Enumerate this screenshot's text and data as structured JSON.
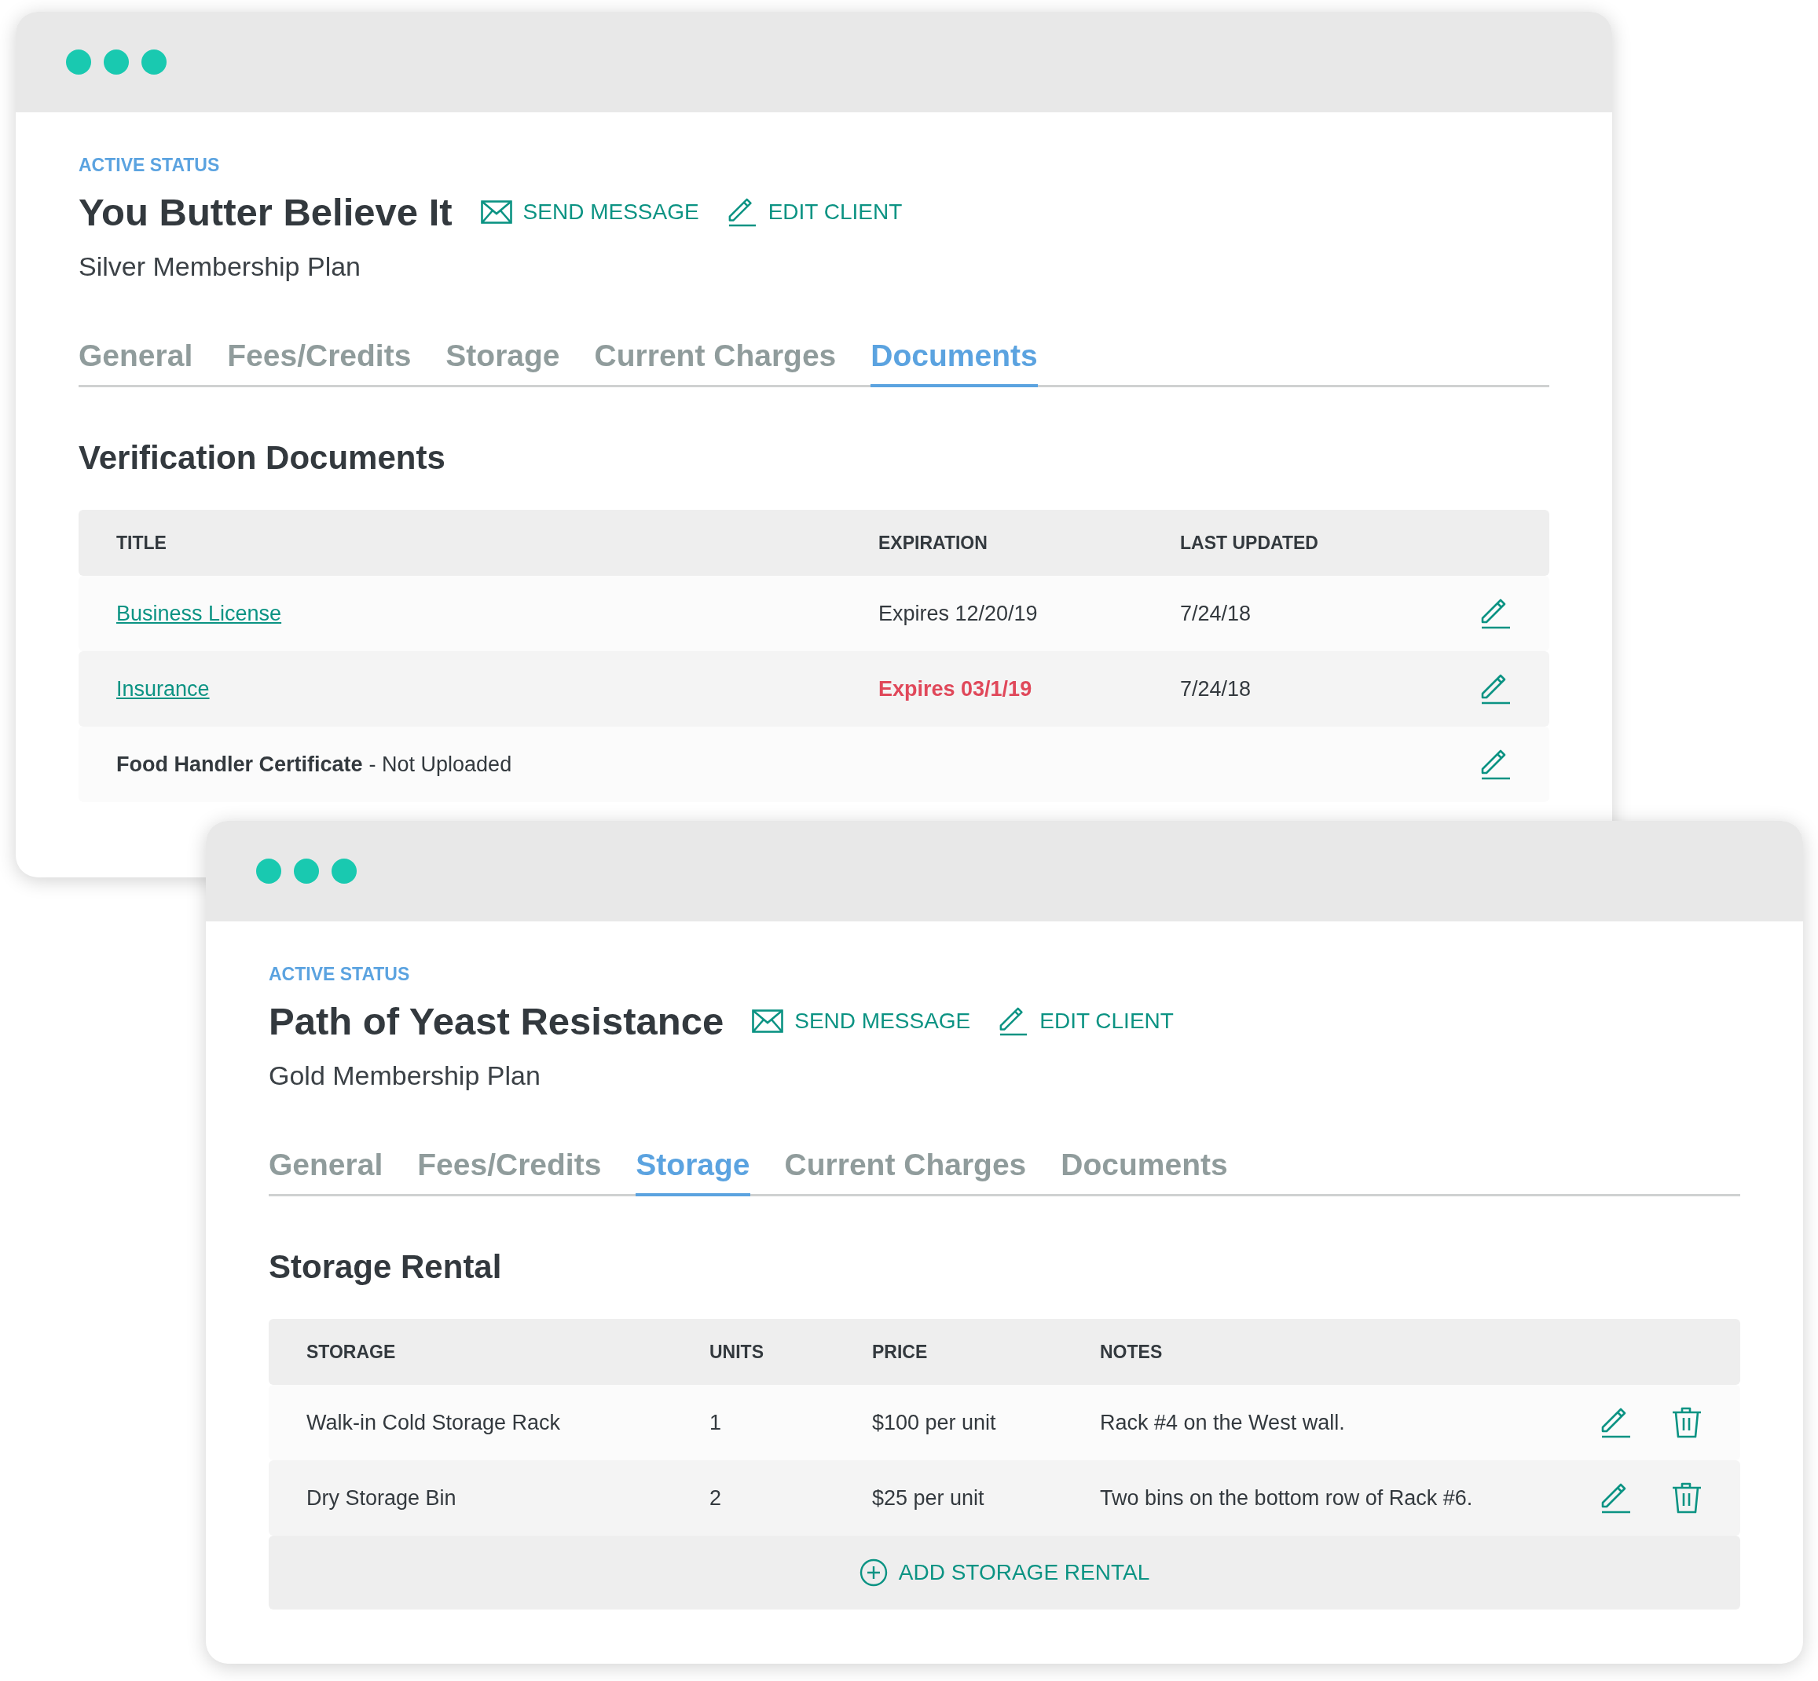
{
  "windows": [
    {
      "status": "ACTIVE STATUS",
      "name": "You Butter Believe It",
      "actions": [
        {
          "kind": "message",
          "label": "SEND MESSAGE"
        },
        {
          "kind": "edit",
          "label": "EDIT CLIENT"
        }
      ],
      "plan": "Silver Membership Plan",
      "tabs": [
        {
          "label": "General",
          "selected": false
        },
        {
          "label": "Fees/Credits",
          "selected": false
        },
        {
          "label": "Storage",
          "selected": false
        },
        {
          "label": "Current Charges",
          "selected": false
        },
        {
          "label": "Documents",
          "selected": true
        }
      ],
      "section_title": "Verification Documents",
      "table": {
        "kind": "documents",
        "columns": [
          "TITLE",
          "EXPIRATION",
          "LAST UPDATED"
        ],
        "rows": [
          {
            "title": "Business License",
            "kind": "link",
            "expiration": "Expires 12/20/19",
            "expired": false,
            "last_updated": "7/24/18"
          },
          {
            "title": "Insurance",
            "kind": "link",
            "expiration": "Expires 03/1/19",
            "expired": true,
            "last_updated": "7/24/18"
          },
          {
            "title": "Food Handler Certificate",
            "kind": "text",
            "note": "- Not Uploaded"
          }
        ]
      }
    },
    {
      "status": "ACTIVE STATUS",
      "name": "Path of Yeast Resistance",
      "actions": [
        {
          "kind": "message",
          "label": "SEND MESSAGE"
        },
        {
          "kind": "edit",
          "label": "EDIT CLIENT"
        }
      ],
      "plan": "Gold Membership Plan",
      "tabs": [
        {
          "label": "General",
          "selected": false
        },
        {
          "label": "Fees/Credits",
          "selected": false
        },
        {
          "label": "Storage",
          "selected": true
        },
        {
          "label": "Current Charges",
          "selected": false
        },
        {
          "label": "Documents",
          "selected": false
        }
      ],
      "section_title": "Storage Rental",
      "table": {
        "kind": "storage",
        "columns": [
          "STORAGE",
          "UNITS",
          "PRICE",
          "NOTES"
        ],
        "rows": [
          {
            "storage": "Walk-in Cold Storage Rack",
            "units": "1",
            "price": "$100 per unit",
            "notes": "Rack #4 on the West wall."
          },
          {
            "storage": "Dry Storage Bin",
            "units": "2",
            "price": "$25 per unit",
            "notes": "Two bins on the bottom row of Rack #6."
          }
        ],
        "add_label": "ADD STORAGE RENTAL"
      }
    }
  ]
}
